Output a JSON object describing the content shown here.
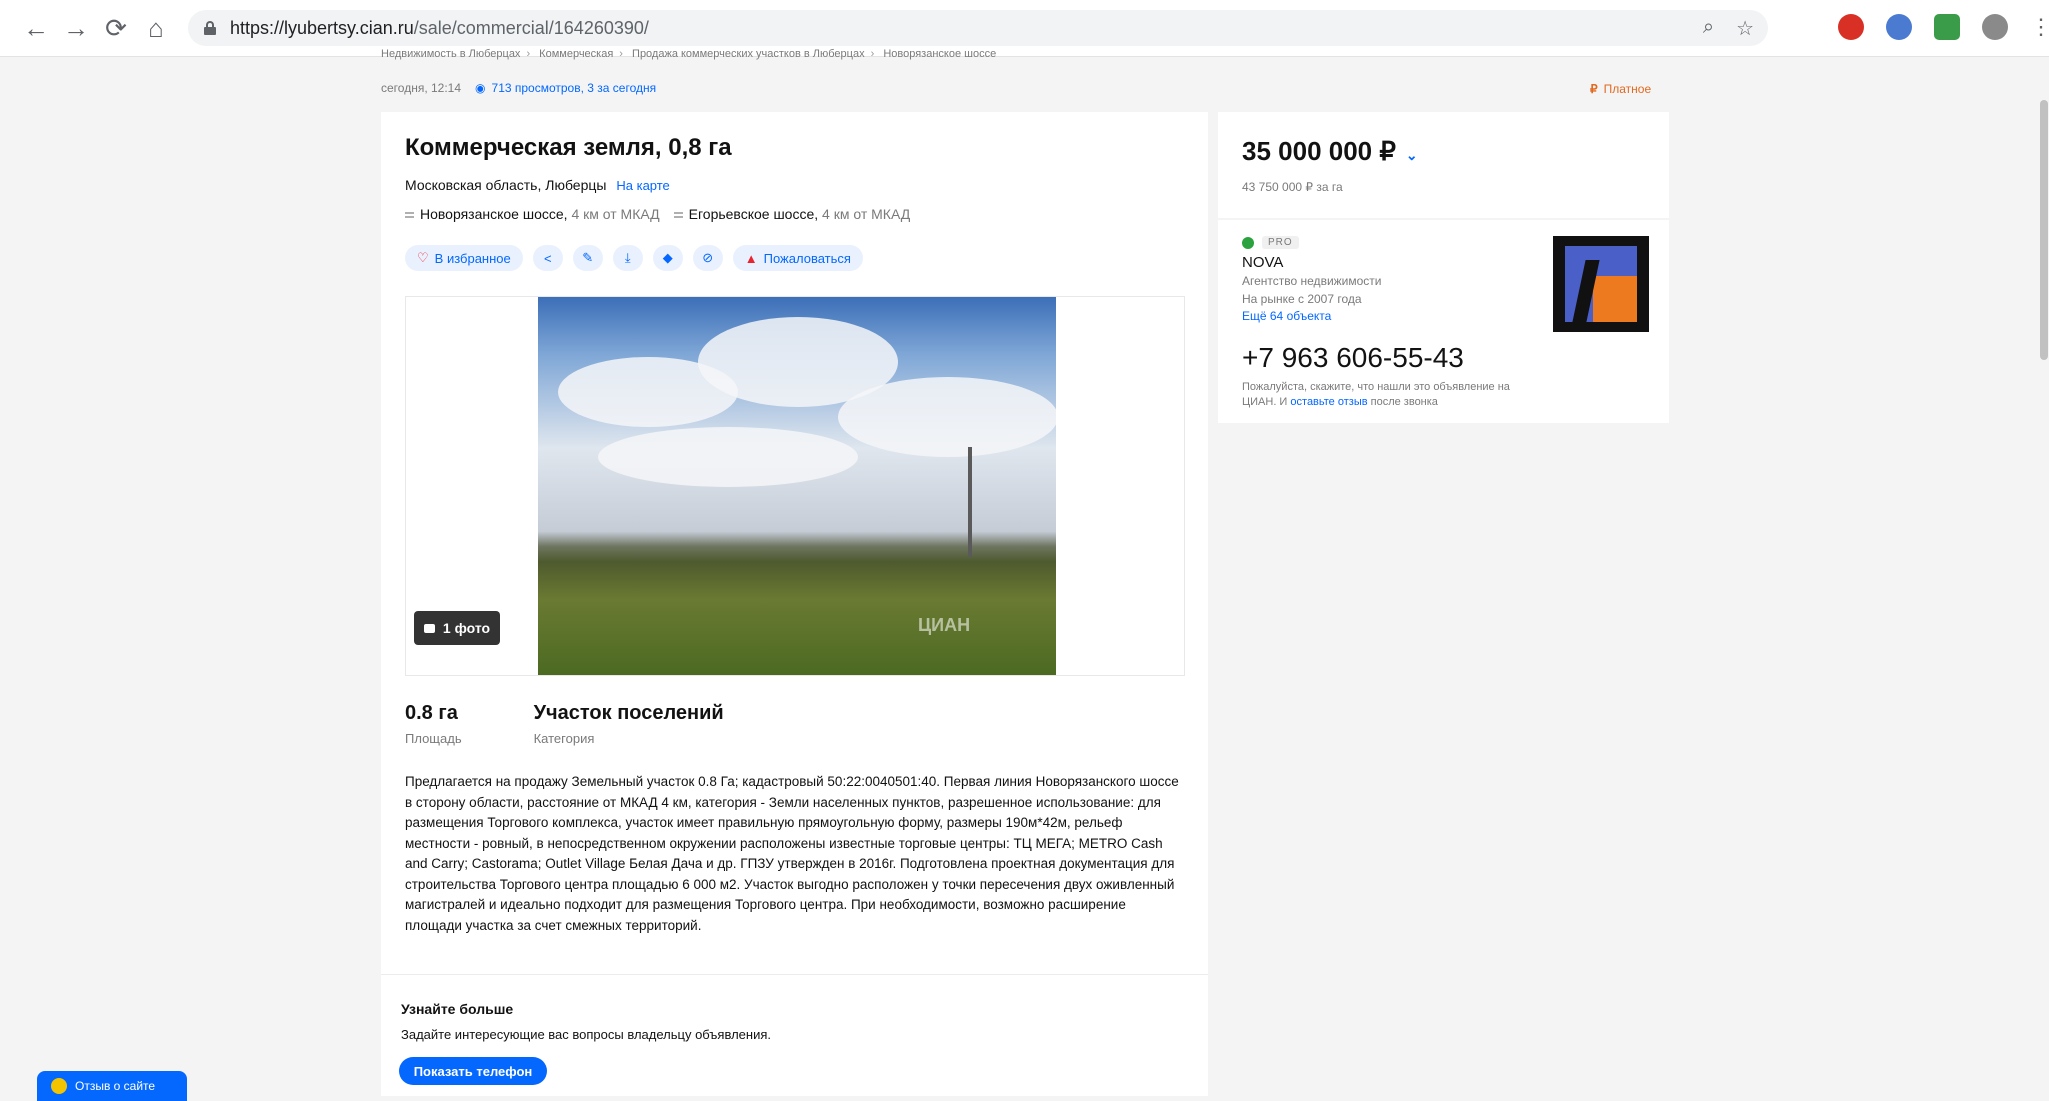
{
  "browser": {
    "url_host": "https://lyubertsy.cian.ru",
    "url_path": "/sale/commercial/164260390/",
    "nav_icons": [
      "back-arrow-icon",
      "forward-arrow-icon",
      "reload-icon",
      "home-icon"
    ],
    "omnibox_icons": [
      "zoom-icon",
      "star-icon"
    ]
  },
  "breadcrumbs": [
    "Недвижимость в Люберцах",
    "Коммерческая",
    "Продажа коммерческих участков в Люберцах",
    "Новорязанское шоссе"
  ],
  "meta": {
    "published": "сегодня, 12:14",
    "views": "713 просмотров, 3 за сегодня",
    "paid_label": "Платное",
    "paid_symbol": "₽"
  },
  "listing": {
    "title": "Коммерческая земля, 0,8 га",
    "address": "Московская область, Люберцы",
    "map_link": "На карте",
    "highways": [
      {
        "name": "Новорязанское шоссе,",
        "distance": "4 км от МКАД"
      },
      {
        "name": "Егорьевское шоссе,",
        "distance": "4 км от МКАД"
      }
    ],
    "actions": {
      "favorite": "В избранное",
      "complain": "Пожаловаться"
    },
    "photo_count": "1 фото",
    "watermark": "ЦИАН",
    "facts": [
      {
        "value": "0.8 га",
        "label": "Площадь"
      },
      {
        "value": "Участок поселений",
        "label": "Категория"
      }
    ],
    "description": "Предлагается на продажу Земельный участок 0.8 Га; кадастровый 50:22:0040501:40. Первая линия Новорязанского шоссе в сторону области, расстояние от МКАД 4 км, категория - Земли населенных пунктов, разрешенное использование: для размещения Торгового комплекса, участок имеет правильную прямоугольную форму, размеры 190м*42м, рельеф местности - ровный, в непосредственном окружении расположены известные торговые центры: ТЦ МЕГА; METRO Cash and Carry; Castorama; Outlet Village Белая Дача и др. ГПЗУ утвержден в 2016г. Подготовлена проектная документация для строительства Торгового центра площадью 6 000 м2. Участок выгодно расположен у точки пересечения двух оживленный магистралей и идеально подходит для размещения Торгового центра. При необходимости, возможно расширение площади участка за счет смежных территорий."
  },
  "learn_more": {
    "heading": "Узнайте больше",
    "text": "Задайте интересующие вас вопросы владельцу объявления.",
    "button": "Показать телефон"
  },
  "price": {
    "value": "35 000 000 ₽",
    "per_unit": "43 750 000 ₽ за га"
  },
  "agent": {
    "badge": "PRO",
    "name": "NOVA",
    "type": "Агентство недвижимости",
    "since": "На рынке с 2007 года",
    "more_link": "Ещё 64 объекта",
    "phone": "+7 963 606-55-43",
    "note_prefix": "Пожалуйста, скажите, что нашли это объявление на ЦИАН. И ",
    "note_link": "оставьте отзыв",
    "note_suffix": " после звонка"
  },
  "feedback_widget": "Отзыв о сайте",
  "colors": {
    "accent": "#0468ff",
    "paid": "#e2691f",
    "page_bg": "#f4f4f4"
  }
}
